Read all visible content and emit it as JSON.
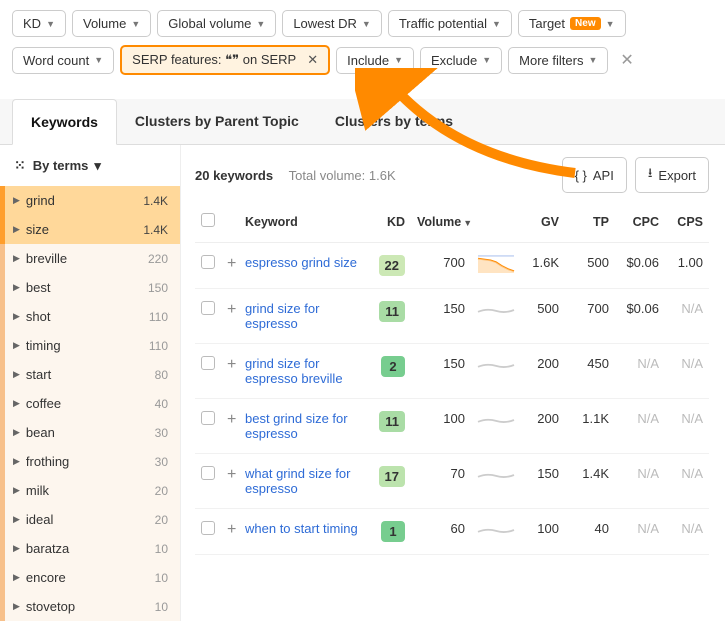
{
  "filters": {
    "row1": [
      {
        "label": "KD"
      },
      {
        "label": "Volume"
      },
      {
        "label": "Global volume"
      },
      {
        "label": "Lowest DR"
      },
      {
        "label": "Traffic potential"
      },
      {
        "label": "Target",
        "new": "New"
      }
    ],
    "row2_prefix": [
      {
        "label": "Word count"
      }
    ],
    "serp_chip_label": "SERP features: ❝❞ on SERP",
    "row2_suffix": [
      {
        "label": "Include"
      },
      {
        "label": "Exclude"
      },
      {
        "label": "More filters"
      }
    ]
  },
  "tabs": [
    {
      "label": "Keywords",
      "active": true
    },
    {
      "label": "Clusters by Parent Topic"
    },
    {
      "label": "Clusters by terms"
    }
  ],
  "sidebar": {
    "byterms": "By terms",
    "terms": [
      {
        "name": "grind",
        "count": "1.4K",
        "active": true
      },
      {
        "name": "size",
        "count": "1.4K",
        "active": true
      },
      {
        "name": "breville",
        "count": "220"
      },
      {
        "name": "best",
        "count": "150"
      },
      {
        "name": "shot",
        "count": "110"
      },
      {
        "name": "timing",
        "count": "110"
      },
      {
        "name": "start",
        "count": "80"
      },
      {
        "name": "coffee",
        "count": "40"
      },
      {
        "name": "bean",
        "count": "30"
      },
      {
        "name": "frothing",
        "count": "30"
      },
      {
        "name": "milk",
        "count": "20"
      },
      {
        "name": "ideal",
        "count": "20"
      },
      {
        "name": "baratza",
        "count": "10"
      },
      {
        "name": "encore",
        "count": "10"
      },
      {
        "name": "stovetop",
        "count": "10"
      }
    ]
  },
  "summary": {
    "count_label": "20 keywords",
    "total_label": "Total volume: 1.6K"
  },
  "actions": {
    "api": "API",
    "export": "Export"
  },
  "columns": {
    "keyword": "Keyword",
    "kd": "KD",
    "volume": "Volume",
    "gv": "GV",
    "tp": "TP",
    "cpc": "CPC",
    "cps": "CPS"
  },
  "rows": [
    {
      "keyword": "espresso grind size",
      "kd": 22,
      "kd_bg": "#cce8b5",
      "volume": "700",
      "gv": "1.6K",
      "tp": "500",
      "cpc": "$0.06",
      "cps": "1.00",
      "spark": "trend"
    },
    {
      "keyword": "grind size for espresso",
      "kd": 11,
      "kd_bg": "#a9dca5",
      "volume": "150",
      "gv": "500",
      "tp": "700",
      "cpc": "$0.06",
      "cps": "N/A",
      "spark": "flat"
    },
    {
      "keyword": "grind size for espresso breville",
      "kd": 2,
      "kd_bg": "#77cd8f",
      "volume": "150",
      "gv": "200",
      "tp": "450",
      "cpc": "N/A",
      "cps": "N/A",
      "spark": "flat"
    },
    {
      "keyword": "best grind size for espresso",
      "kd": 11,
      "kd_bg": "#a9dca5",
      "volume": "100",
      "gv": "200",
      "tp": "1.1K",
      "cpc": "N/A",
      "cps": "N/A",
      "spark": "flat"
    },
    {
      "keyword": "what grind size for espresso",
      "kd": 17,
      "kd_bg": "#bce3ad",
      "volume": "70",
      "gv": "150",
      "tp": "1.4K",
      "cpc": "N/A",
      "cps": "N/A",
      "spark": "flat"
    },
    {
      "keyword": "when to start timing",
      "kd": 1,
      "kd_bg": "#77cd8f",
      "volume": "60",
      "gv": "100",
      "tp": "40",
      "cpc": "N/A",
      "cps": "N/A",
      "spark": "flat"
    }
  ]
}
